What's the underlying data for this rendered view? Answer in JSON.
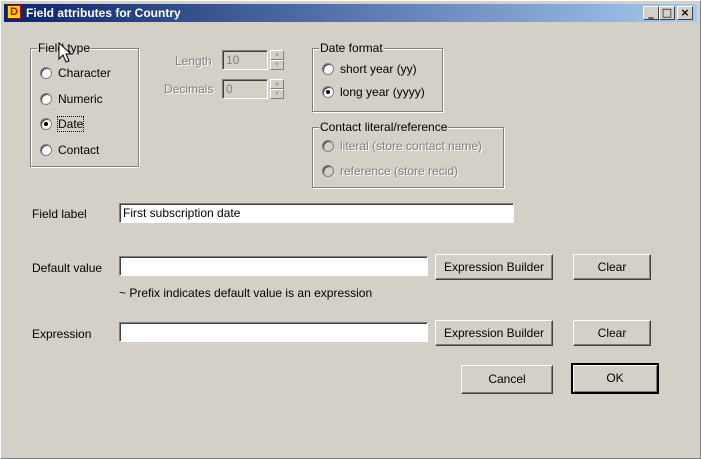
{
  "window": {
    "title": "Field attributes for Country"
  },
  "field_type": {
    "legend": "Field type",
    "options": [
      {
        "label": "Character",
        "checked": false
      },
      {
        "label": "Numeric",
        "checked": false
      },
      {
        "label": "Date",
        "checked": true
      },
      {
        "label": "Contact",
        "checked": false
      }
    ]
  },
  "length": {
    "label": "Length",
    "value": "10"
  },
  "decimals": {
    "label": "Decimals",
    "value": "0"
  },
  "date_format": {
    "legend": "Date format",
    "options": [
      {
        "label": "short year (yy)",
        "checked": false
      },
      {
        "label": "long year (yyyy)",
        "checked": true
      }
    ]
  },
  "contact_literal": {
    "legend": "Contact literal/reference",
    "options": [
      {
        "label": "literal (store contact name)",
        "checked": false
      },
      {
        "label": "reference (store recid)",
        "checked": false
      }
    ]
  },
  "field_label": {
    "label": "Field label",
    "value": "First subscription date"
  },
  "default_value": {
    "label": "Default value",
    "value": "",
    "hint": "~ Prefix indicates  default value is an expression"
  },
  "expression": {
    "label": "Expression",
    "value": ""
  },
  "buttons": {
    "expression_builder": "Expression Builder",
    "clear": "Clear",
    "cancel": "Cancel",
    "ok": "OK"
  },
  "colors": {
    "titlebar_start": "#0a246a",
    "titlebar_end": "#a6caf0",
    "face": "#d4d0c8"
  }
}
